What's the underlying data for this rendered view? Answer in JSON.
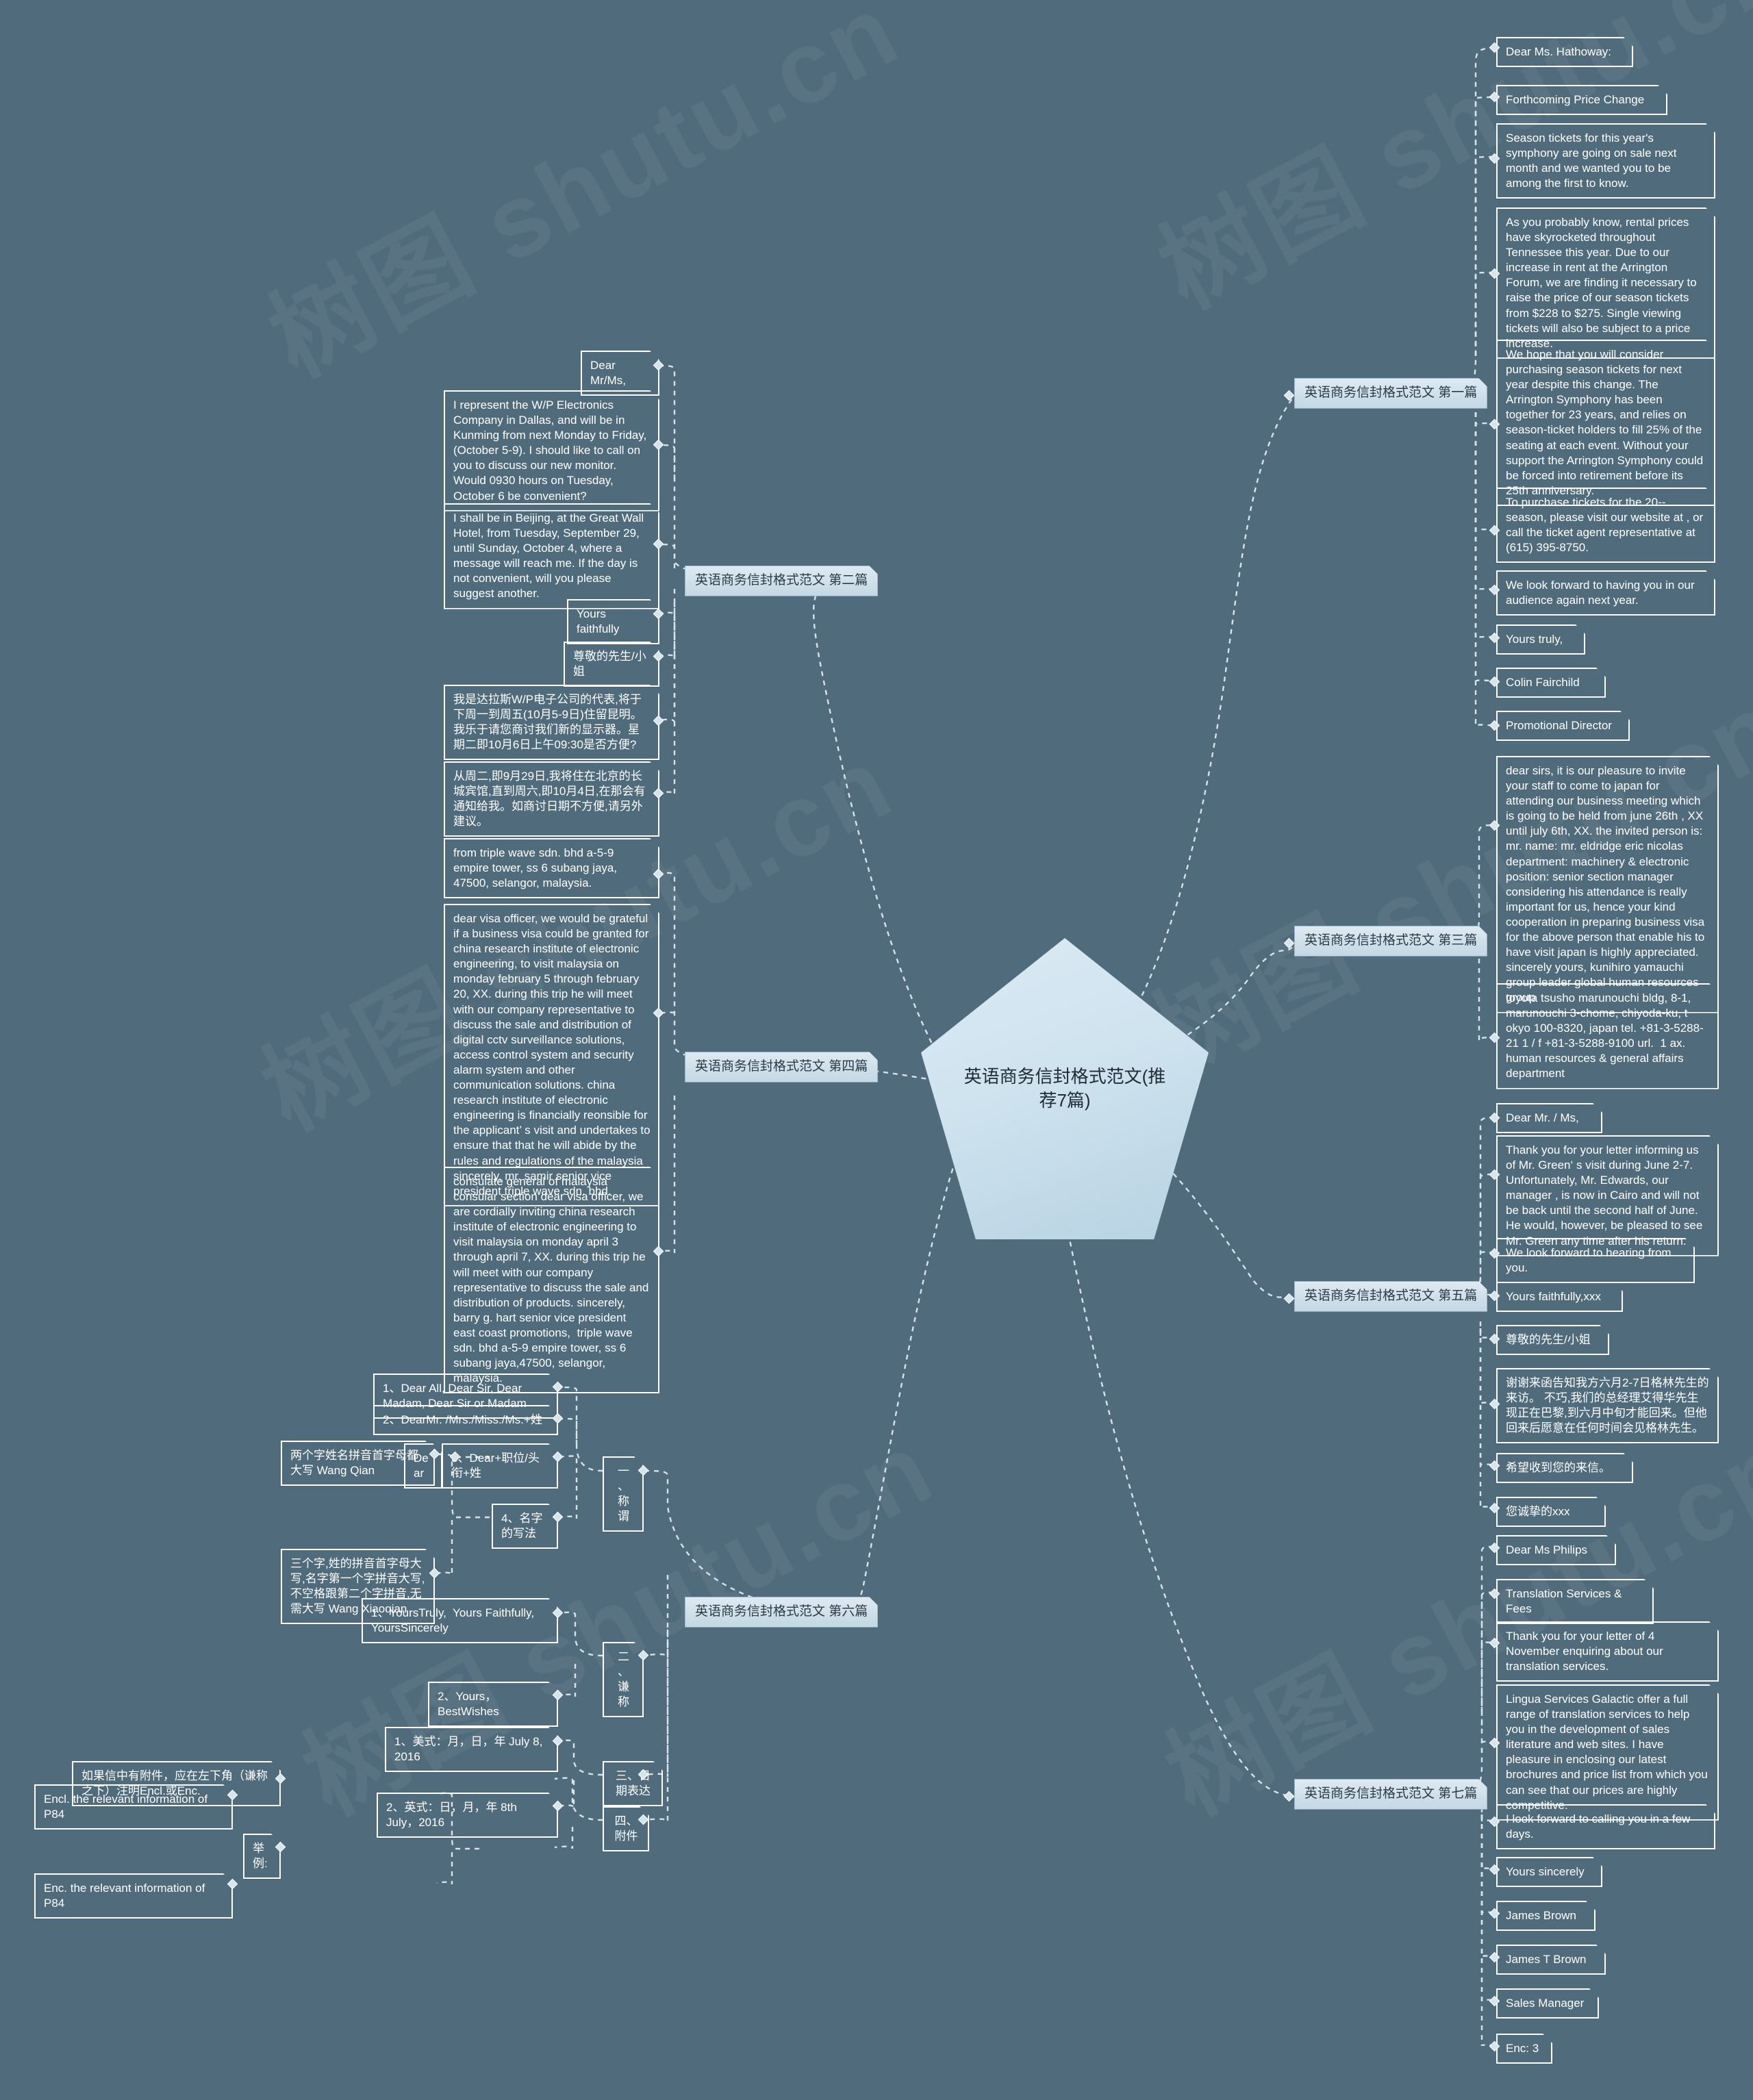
{
  "meta": {
    "central_topic": "英语商务信封格式范文(推荐7篇)",
    "watermark": "树图 shutu.cn",
    "background_color": "#506B7C",
    "node_border_color": "#FFFFFF",
    "branch_fill_color": "#D4E4EE",
    "central_fill_color": "#CFE3EF"
  },
  "branches": [
    {
      "id": "b1",
      "label": "英语商务信封格式范文 第一篇",
      "children": [
        "Dear Ms. Hathoway:",
        "Forthcoming Price Change",
        "Season tickets for this year's symphony are going on sale next month and we wanted you to be among the first to know.",
        "As you probably know, rental prices have skyrocketed throughout Tennessee this year. Due to our increase in rent at the Arrington Forum, we are finding it necessary to raise the price of our season tickets from $228 to $275. Single viewing tickets will also be subject to a price increase.",
        "We hope that you will consider purchasing season tickets for next year despite this change. The Arrington Symphony has been together for 23 years, and relies on season-ticket holders to fill 25% of the seating at each event. Without your support the Arrington Symphony could be forced into retirement before its 25th anniversary.",
        "To purchase tickets for the 20-- season, please visit our website at , or call the ticket agent representative at (615) 395-8750.",
        "We look forward to having you in our audience again next year.",
        "Yours truly,",
        "Colin Fairchild",
        "Promotional Director"
      ]
    },
    {
      "id": "b2",
      "label": "英语商务信封格式范文 第二篇",
      "children": [
        "Dear Mr/Ms,",
        "I represent the W/P Electronics Company in Dallas, and will be in Kunming from next Monday to Friday, (October 5-9). I should like to call on you to discuss our new monitor. Would 0930 hours on Tuesday, October 6 be convenient?",
        "I shall be in Beijing, at the Great Wall Hotel, from Tuesday, September 29, until Sunday, October 4, where a message will reach me. If the day is not convenient, will you please suggest another.",
        "Yours faithfully",
        "尊敬的先生/小姐",
        "我是达拉斯W/P电子公司的代表,将于下周一到周五(10月5-9日)住留昆明。我乐于请您商讨我们新的显示器。星期二即10月6日上午09:30是否方便?",
        "从周二,即9月29日,我将住在北京的长城宾馆,直到周六,即10月4日,在那会有通知给我。如商讨日期不方便,请另外建议。"
      ]
    },
    {
      "id": "b3",
      "label": "英语商务信封格式范文 第三篇",
      "children": [
        "dear sirs, it is our pleasure to invite your staff to come to japan for attending our business meeting which is going to be held from june 26th , XX until july 6th, XX. the invited person is: mr. name: mr. eldridge eric nicolas department: machinery & electronic position: senior section manager considering his attendance is really important for us, hence your kind cooperation in preparing business visa for the above person that enable his to have visit japan is highly appreciated. sincerely yours, kunihiro yamauchi group leader global human resources group",
        "toyota tsusho marunouchi bldg, 8-1, marunouchi 3-chome, chiyoda-ku, t okyo 100-8320, japan tel. +81-3-5288-21 1 / f +81-3-5288-9100 url.  1 ax. human resources & general affairs department"
      ]
    },
    {
      "id": "b4",
      "label": "英语商务信封格式范文 第四篇",
      "children": [
        "from triple wave sdn. bhd a-5-9 empire tower, ss 6 subang jaya, 47500, selangor, malaysia.",
        "dear visa officer, we would be grateful if a business visa could be granted for china research institute of electronic engineering, to visit malaysia on monday february 5 through february 20, XX. during this trip he will meet with our company representative to discuss the sale and distribution of digital cctv surveillance solutions, access control system and security alarm system and other communication solutions. china research institute of electronic engineering is financially reonsible for the applicant’ s visit and undertakes to ensure that that he will abide by the rules and regulations of the malaysia sincerely, mr. samir senior vice president triple wave sdn. bhd.",
        "consulate general of malaysia consular section dear visa officer, we are cordially inviting china research institute of electronic engineering to visit malaysia on monday april 3 through april 7, XX. during this trip he will meet with our company representative to discuss the sale and distribution of products. sincerely, barry g. hart senior vice president east coast promotions,  triple wave sdn. bhd a-5-9 empire tower, ss 6 subang jaya,47500, selangor, malaysia."
      ]
    },
    {
      "id": "b5",
      "label": "英语商务信封格式范文 第五篇",
      "children": [
        "Dear Mr. / Ms,",
        "Thank you for your letter informing us of Mr. Green‘ s visit during June 2-7. Unfortunately, Mr. Edwards, our manager , is now in Cairo and will not be back until the second half of June. He would, however, be pleased to see Mr. Green any time after his return.",
        "We look forward to hearing from you.",
        "Yours faithfully,xxx",
        "尊敬的先生/小姐",
        "谢谢来函告知我方六月2-7日格林先生的来访。 不巧,我们的总经理艾得华先生现正在巴黎,到六月中旬才能回来。但他回来后愿意在任何时间会见格林先生。",
        "希望收到您的来信。",
        "您诚挚的xxx"
      ]
    },
    {
      "id": "b6",
      "label": "英语商务信封格式范文 第六篇",
      "sub": [
        {
          "label": "一、称谓",
          "items": [
            {
              "text": "1、Dear All, Dear Sir, Dear Madam, Dear Sir or Madam"
            },
            {
              "text": "2、DearMr. /Mrs./Miss./Ms.+姓"
            },
            {
              "text": "3、Dear+职位/头衔+姓",
              "leaf": "Dear"
            },
            {
              "text": "4、名字的写法",
              "leaves": [
                "两个字姓名拼音首字母都大写 Wang Qian",
                "三个字,姓的拼音首字母大写,名字第一个字拼音大写,不空格跟第二个字拼音,无需大写 Wang Xiaoqian"
              ]
            }
          ]
        },
        {
          "label": "二、谦称",
          "items": [
            {
              "text": "1、YoursTruly,  Yours Faithfully, YoursSincerely"
            },
            {
              "text": "2、Yours，BestWishes"
            }
          ]
        },
        {
          "label": "三、日期表达",
          "items": [
            {
              "text": "1、美式：月，日，年 July 8, 2016"
            },
            {
              "text": "2、英式：日，月，年 8th July，2016"
            }
          ]
        },
        {
          "label": "四、附件",
          "items": [
            {
              "text": "如果信中有附件，应在左下角（谦称之下）注明Encl.或Enc."
            },
            {
              "text": "举例:",
              "leaves": [
                "Encl. the relevant information of P84",
                "Enc. the relevant information of P84"
              ]
            }
          ]
        }
      ]
    },
    {
      "id": "b7",
      "label": "英语商务信封格式范文 第七篇",
      "children": [
        "Dear Ms Philips",
        "Translation Services & Fees",
        "Thank you for your letter of 4 November enquiring about our translation services.",
        "Lingua Services Galactic offer a full range of translation services to help you in the development of sales literature and web sites. I have pleasure in enclosing our latest brochures and price list from which you can see that our prices are highly competitive.",
        "I look forward to calling you in a few days.",
        "Yours sincerely",
        "James Brown",
        "James T Brown",
        "Sales Manager",
        "Enc: 3"
      ]
    }
  ]
}
